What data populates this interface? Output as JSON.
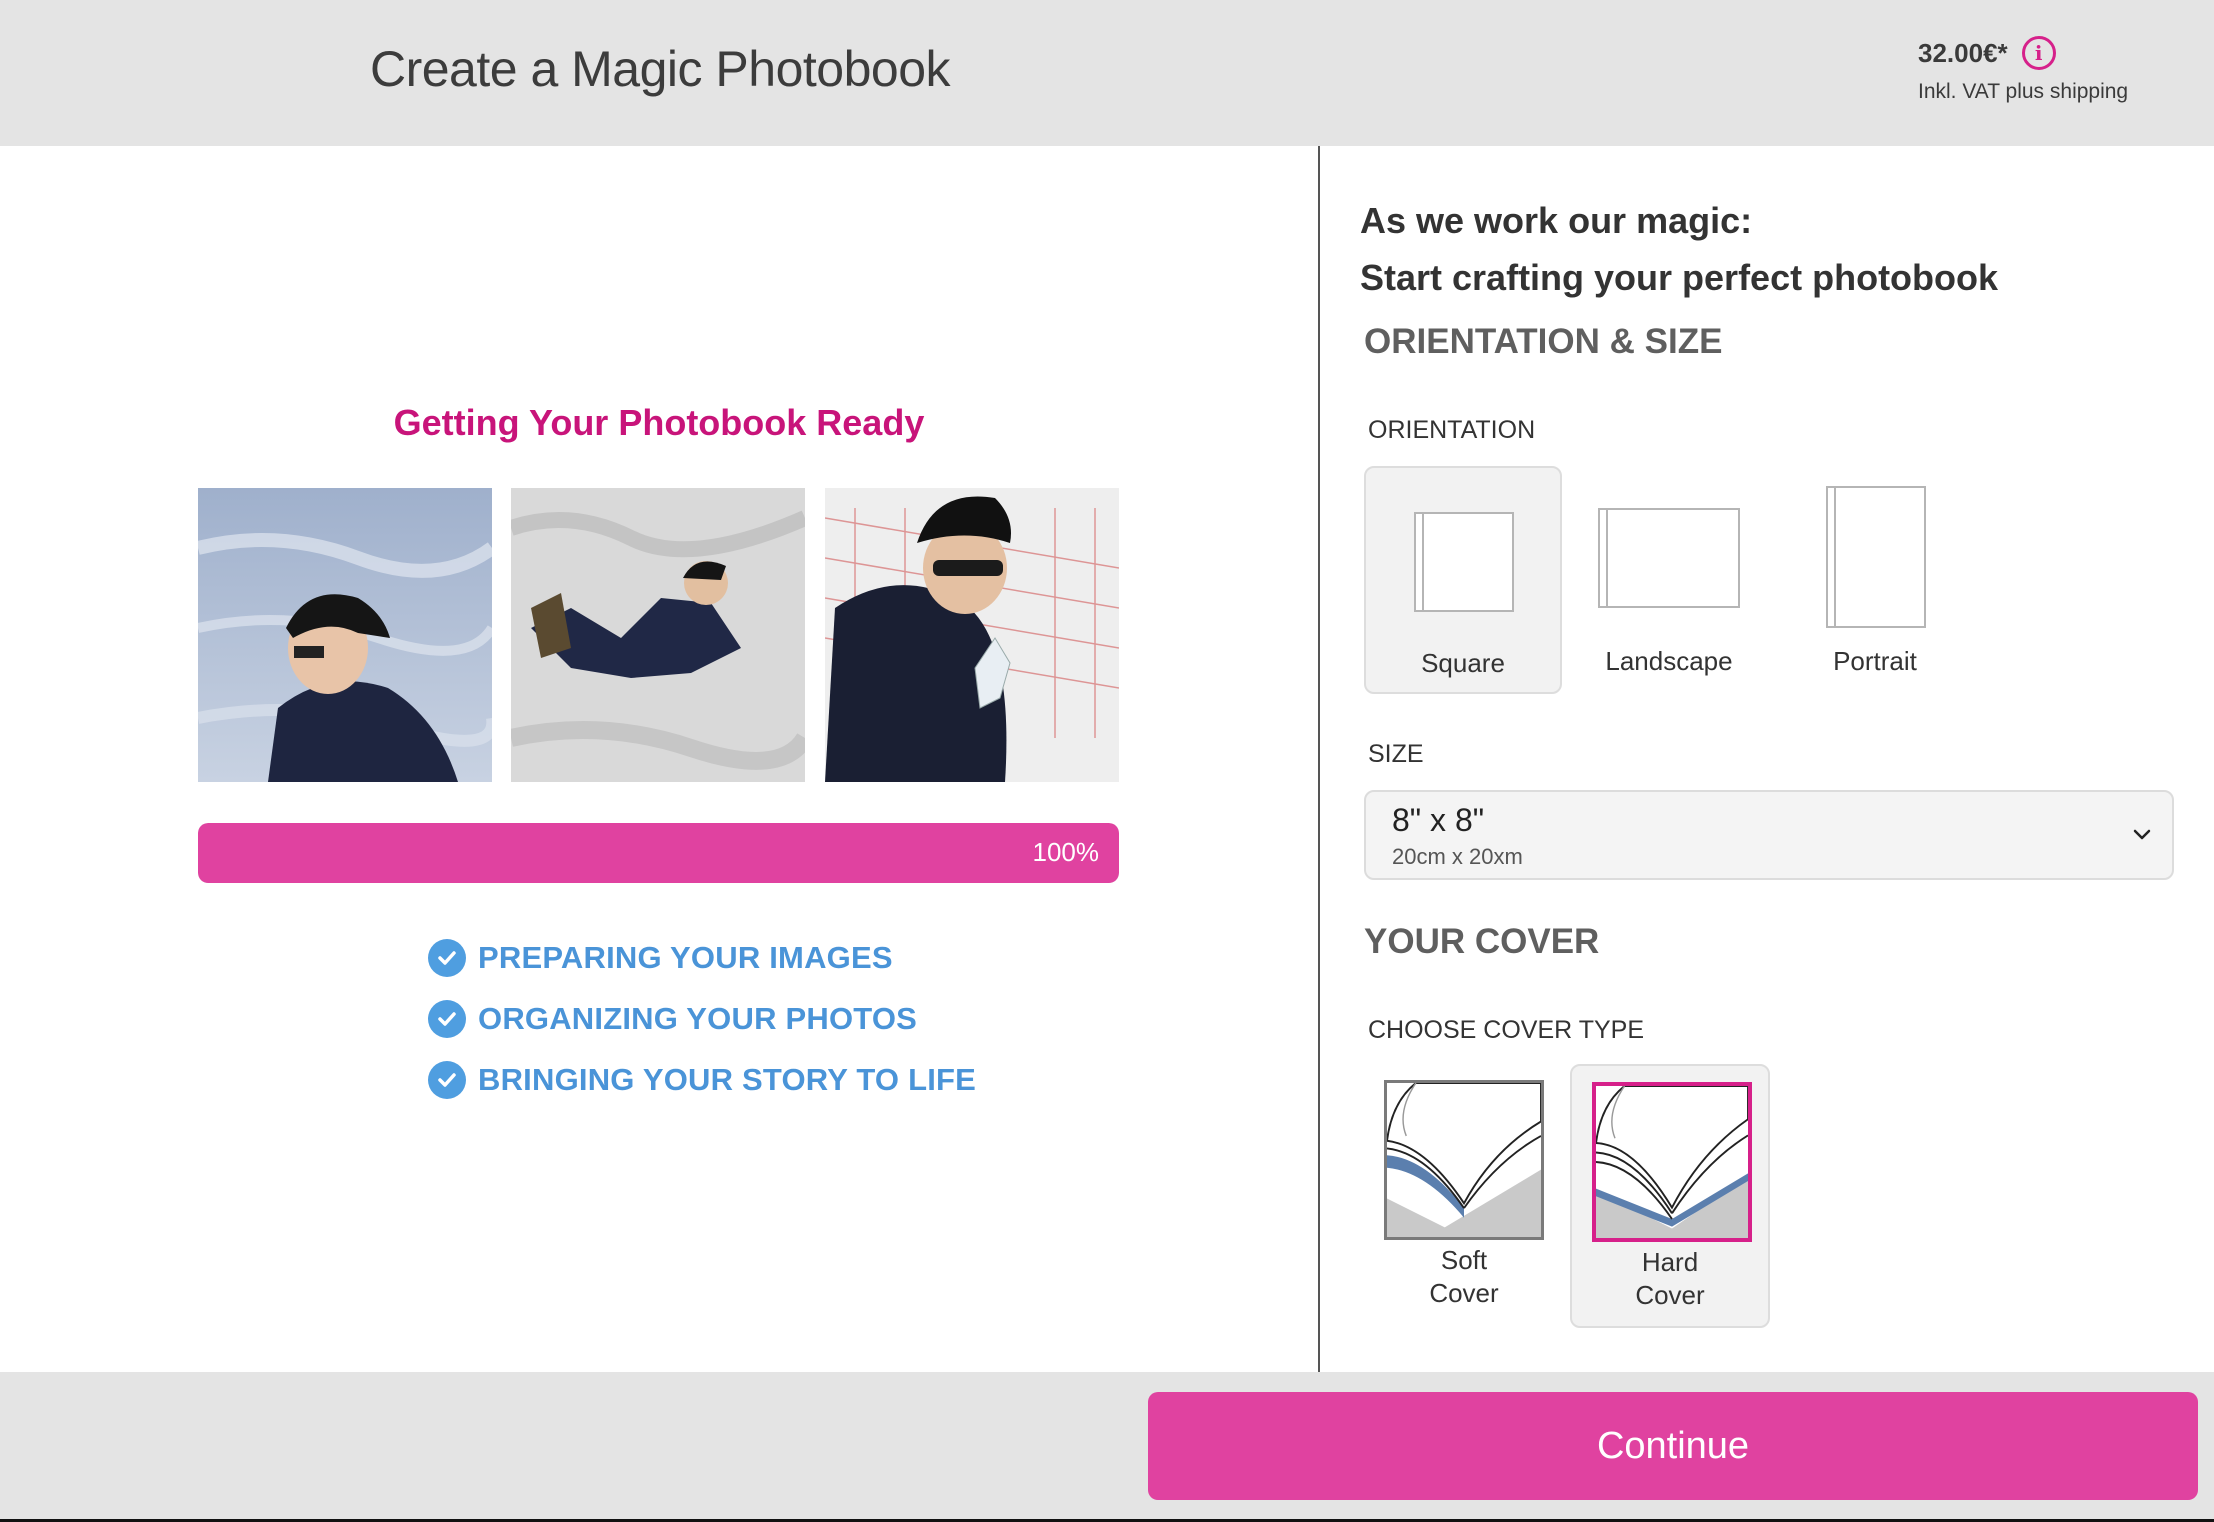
{
  "header": {
    "title": "Create a Magic Photobook",
    "price": "32.00€*",
    "vat_note": "Inkl. VAT plus shipping",
    "info_icon": "info-icon"
  },
  "progress": {
    "title": "Getting Your Photobook Ready",
    "percent": 100,
    "percent_label": "100%",
    "steps": [
      {
        "label": "PREPARING YOUR IMAGES",
        "done": true
      },
      {
        "label": "ORGANIZING YOUR PHOTOS",
        "done": true
      },
      {
        "label": "BRINGING YOUR STORY TO LIFE",
        "done": true
      }
    ]
  },
  "panel": {
    "heading_line1": "As we work our magic:",
    "heading_line2": "Start crafting your perfect photobook",
    "orientation_section": "ORIENTATION & SIZE",
    "orientation_label": "ORIENTATION",
    "orientations": [
      {
        "label": "Square",
        "selected": true
      },
      {
        "label": "Landscape",
        "selected": false
      },
      {
        "label": "Portrait",
        "selected": false
      }
    ],
    "size_label": "SIZE",
    "size_value": "8\" x 8\"",
    "size_sub": "20cm x 20xm",
    "cover_section": "YOUR COVER",
    "cover_type_label": "CHOOSE COVER TYPE",
    "covers": [
      {
        "line1": "Soft",
        "line2": "Cover",
        "selected": false
      },
      {
        "line1": "Hard",
        "line2": "Cover",
        "selected": true
      }
    ]
  },
  "footer": {
    "continue_label": "Continue"
  },
  "colors": {
    "accent": "#e042a0",
    "title_pink": "#c8147a",
    "step_blue": "#4a94d8",
    "header_bg": "#e4e4e4"
  }
}
